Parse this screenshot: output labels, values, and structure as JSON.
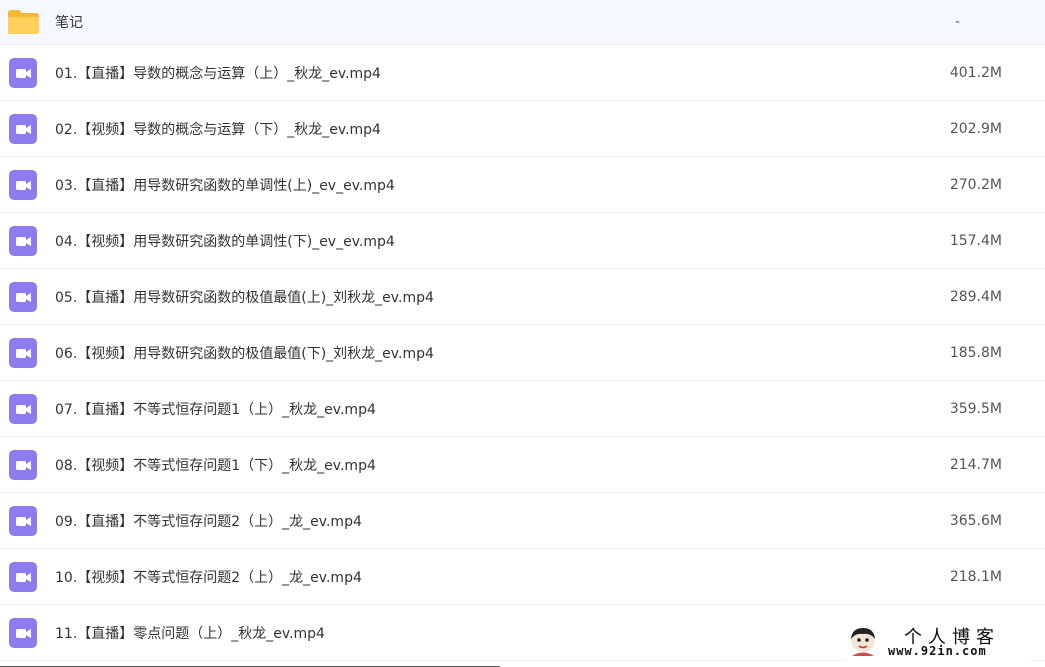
{
  "files": [
    {
      "type": "folder",
      "icon": "folder-icon",
      "name": "笔记",
      "size": "-"
    },
    {
      "type": "video",
      "icon": "video-file-icon",
      "name": "01.【直播】导数的概念与运算（上）_秋龙_ev.mp4",
      "size": "401.2M"
    },
    {
      "type": "video",
      "icon": "video-file-icon",
      "name": "02.【视频】导数的概念与运算（下）_秋龙_ev.mp4",
      "size": "202.9M"
    },
    {
      "type": "video",
      "icon": "video-file-icon",
      "name": "03.【直播】用导数研究函数的单调性(上)_ev_ev.mp4",
      "size": "270.2M"
    },
    {
      "type": "video",
      "icon": "video-file-icon",
      "name": "04.【视频】用导数研究函数的单调性(下)_ev_ev.mp4",
      "size": "157.4M"
    },
    {
      "type": "video",
      "icon": "video-file-icon",
      "name": "05.【直播】用导数研究函数的极值最值(上)_刘秋龙_ev.mp4",
      "size": "289.4M"
    },
    {
      "type": "video",
      "icon": "video-file-icon",
      "name": "06.【视频】用导数研究函数的极值最值(下)_刘秋龙_ev.mp4",
      "size": "185.8M"
    },
    {
      "type": "video",
      "icon": "video-file-icon",
      "name": "07.【直播】不等式恒存问题1（上）_秋龙_ev.mp4",
      "size": "359.5M"
    },
    {
      "type": "video",
      "icon": "video-file-icon",
      "name": "08.【视频】不等式恒存问题1（下）_秋龙_ev.mp4",
      "size": "214.7M"
    },
    {
      "type": "video",
      "icon": "video-file-icon",
      "name": "09.【直播】不等式恒存问题2（上）_龙_ev.mp4",
      "size": "365.6M"
    },
    {
      "type": "video",
      "icon": "video-file-icon",
      "name": "10.【视频】不等式恒存问题2（上）_龙_ev.mp4",
      "size": "218.1M"
    },
    {
      "type": "video",
      "icon": "video-file-icon",
      "name": "11.【直播】零点问题（上）_秋龙_ev.mp4",
      "size": ""
    }
  ],
  "watermark": {
    "title": "个人博客",
    "url": "www.92in.com"
  },
  "colors": {
    "folder": "#ffc94d",
    "folder_tab": "#f7b733",
    "video_icon": "#8b7cf0",
    "text": "#333333",
    "size_text": "#555555",
    "divider": "#eef0f3"
  }
}
